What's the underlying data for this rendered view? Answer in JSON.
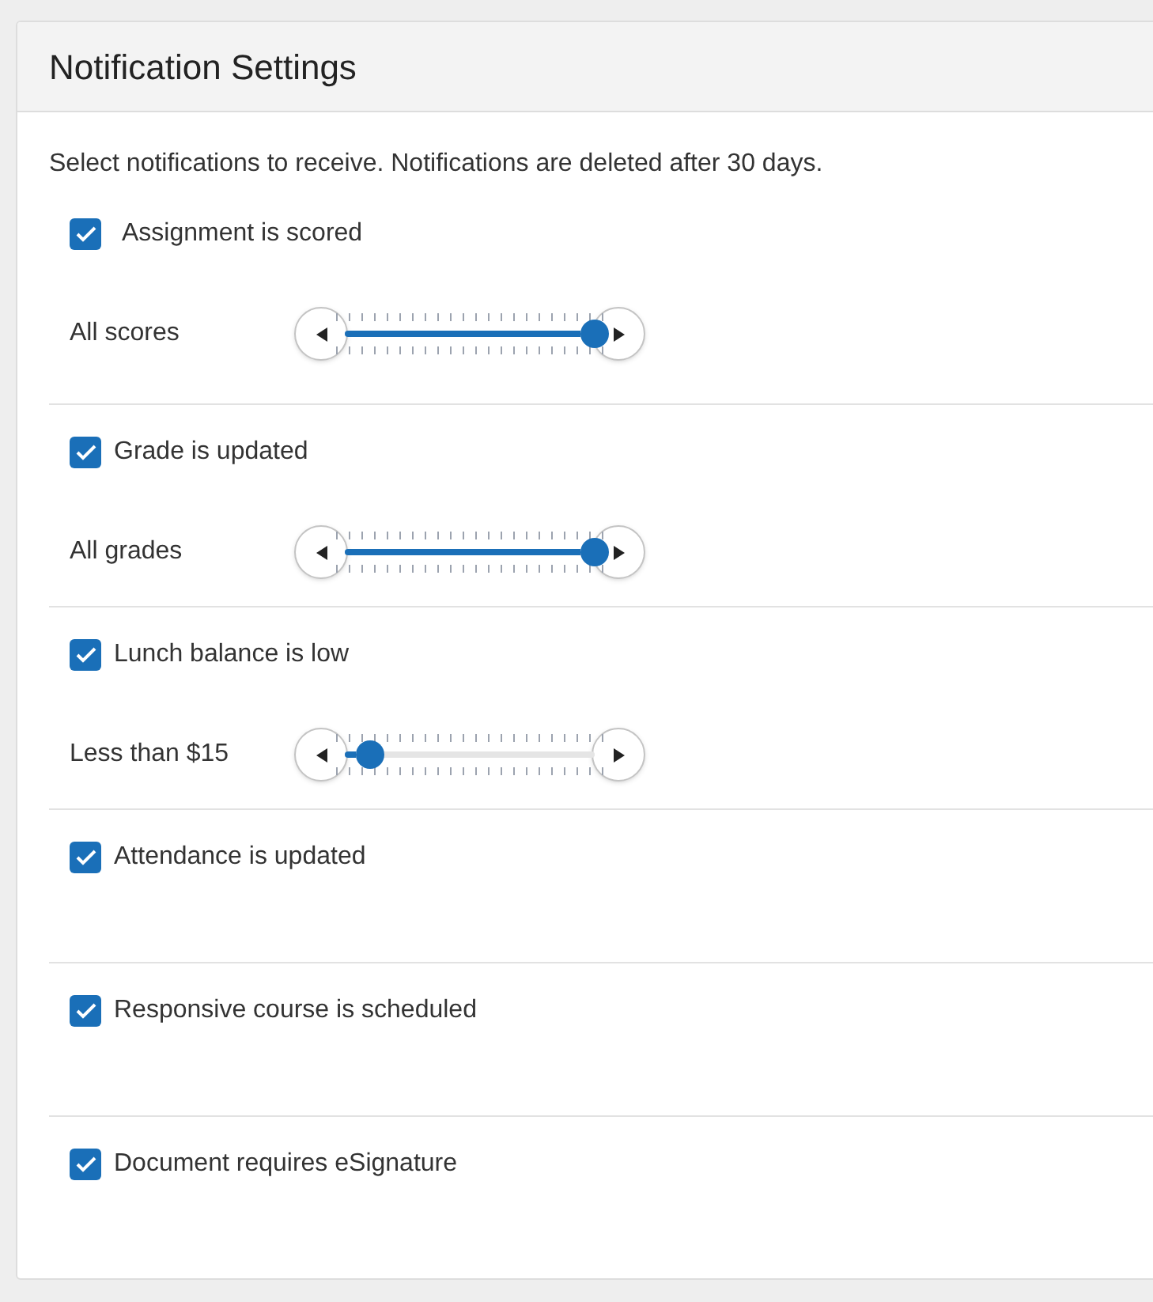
{
  "panel": {
    "title": "Notification Settings",
    "intro": "Select notifications to receive. Notifications are deleted after 30 days.",
    "items": [
      {
        "label": "Assignment is scored",
        "checked": true,
        "slider": {
          "label": "All scores",
          "level": 1
        }
      },
      {
        "label": "Grade is updated",
        "checked": true,
        "slider": {
          "label": "All grades",
          "level": 1
        }
      },
      {
        "label": "Lunch balance is low",
        "checked": true,
        "slider": {
          "label": "Less than $15",
          "level": 0.1
        }
      },
      {
        "label": "Attendance is updated",
        "checked": true
      },
      {
        "label": "Responsive course is scheduled",
        "checked": true
      },
      {
        "label": "Document requires eSignature",
        "checked": true
      }
    ]
  }
}
